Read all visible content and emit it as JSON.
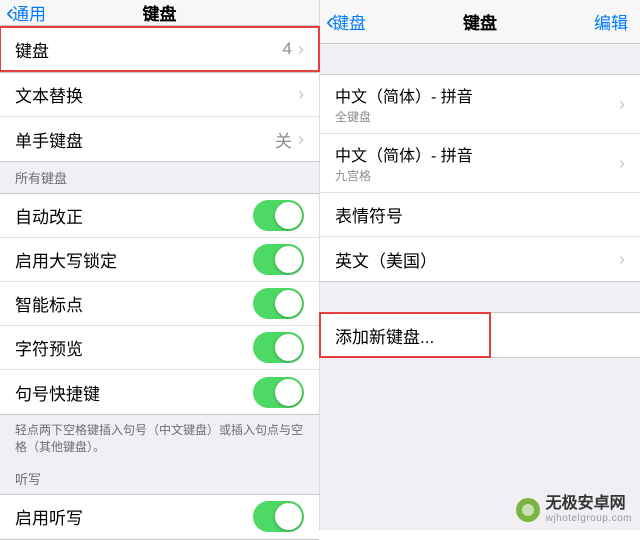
{
  "left": {
    "back": "通用",
    "title": "键盘",
    "rows_keyboards": {
      "label": "键盘",
      "value": "4"
    },
    "rows_text_replace": {
      "label": "文本替换"
    },
    "rows_one_handed": {
      "label": "单手键盘",
      "value": "关"
    },
    "section_all": "所有键盘",
    "auto_correct": "自动改正",
    "caps_lock": "启用大写锁定",
    "smart_punct": "智能标点",
    "char_preview": "字符预览",
    "period_shortcut": "句号快捷键",
    "footer": "轻点两下空格键插入句号（中文键盘）或插入句点与空格（其他键盘）。",
    "section_dictation": "听写",
    "enable_dictation": "启用听写"
  },
  "right": {
    "back": "键盘",
    "title": "键盘",
    "edit": "编辑",
    "kb1": {
      "label": "中文（简体）- 拼音",
      "sub": "全键盘"
    },
    "kb2": {
      "label": "中文（简体）- 拼音",
      "sub": "九宫格"
    },
    "kb3": {
      "label": "表情符号"
    },
    "kb4": {
      "label": "英文（美国）"
    },
    "add_new": "添加新键盘..."
  },
  "watermark": {
    "line1": "无极安卓网",
    "line2": "wjhotelgroup.com"
  }
}
